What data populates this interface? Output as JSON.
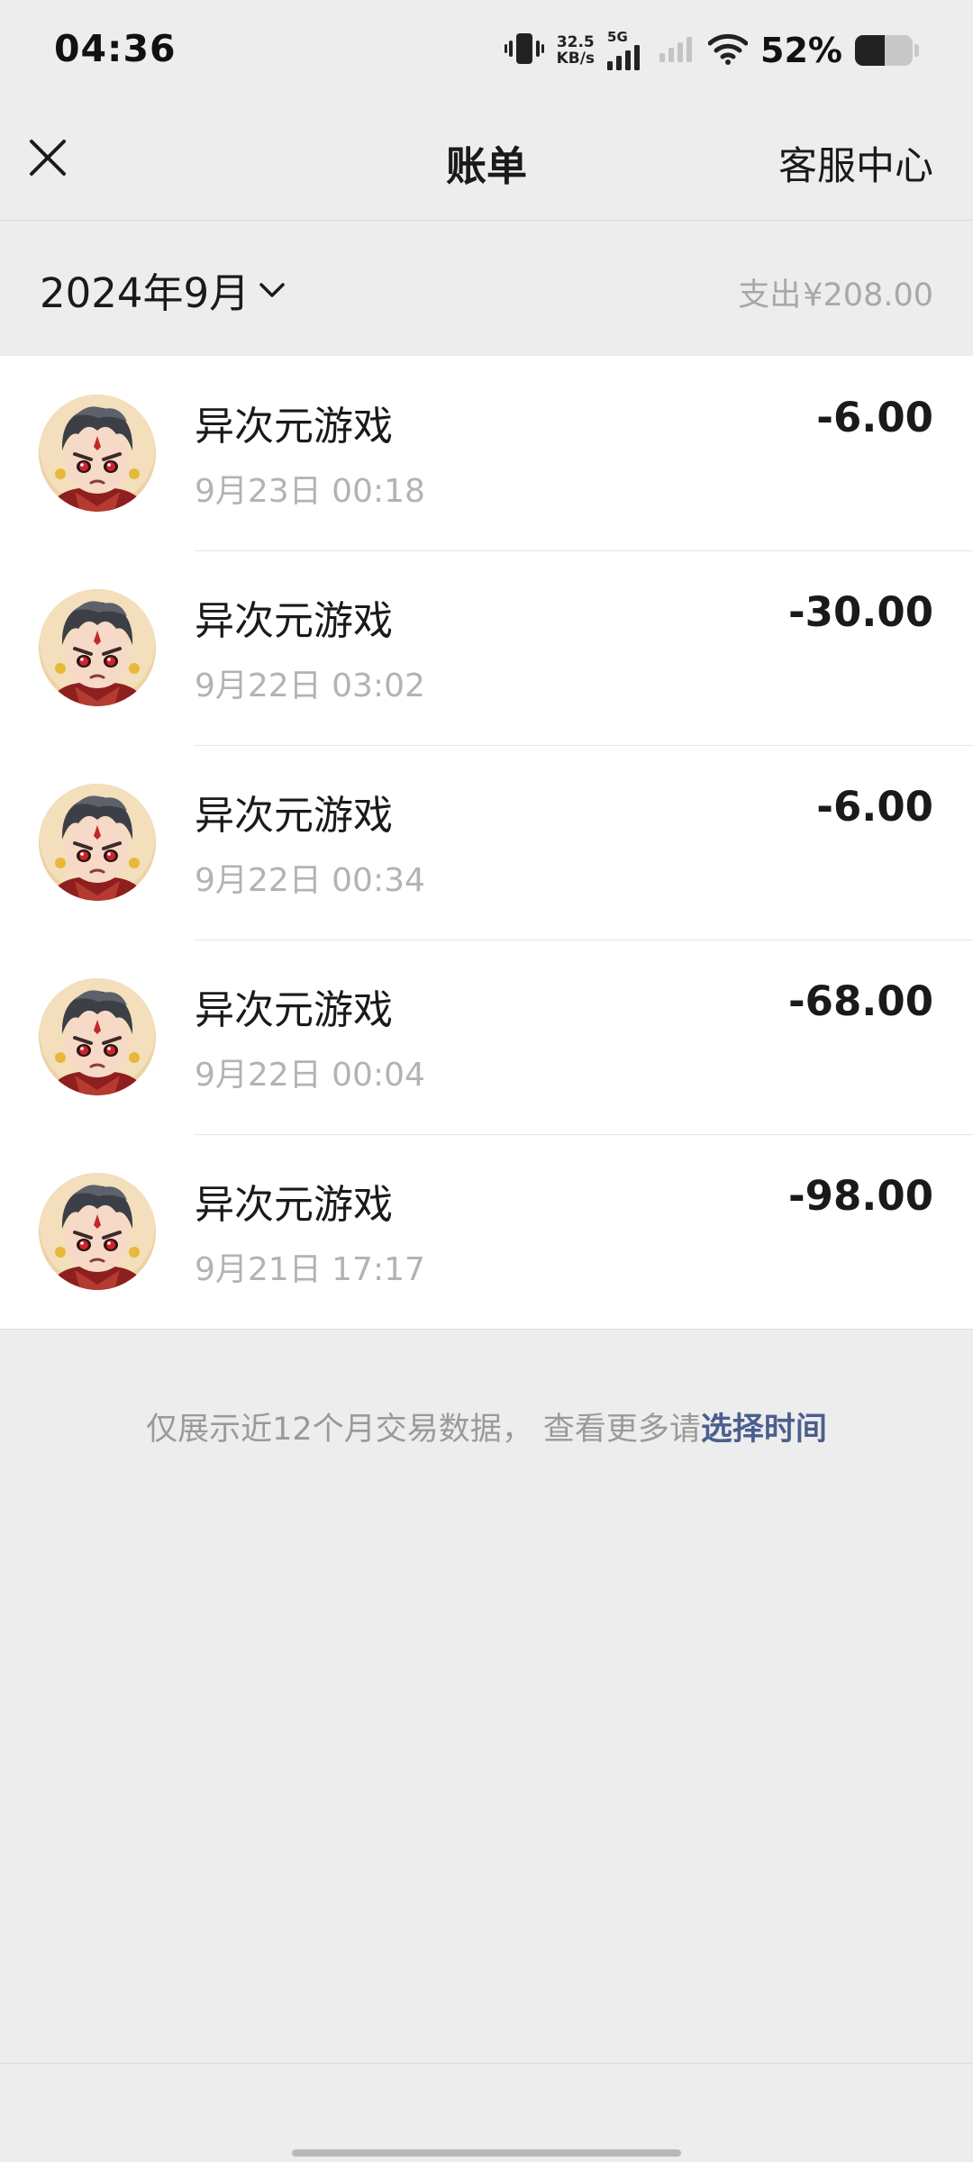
{
  "status_bar": {
    "time": "04:36",
    "net_speed_value": "32.5",
    "net_speed_unit": "KB/s",
    "network_type": "5G",
    "battery_percent": "52%",
    "battery_level": 0.52
  },
  "header": {
    "title": "账单",
    "right_link": "客服中心",
    "close_icon": "close-icon"
  },
  "filter": {
    "month": "2024年9月",
    "expense_label": "支出",
    "expense_amount": "¥208.00"
  },
  "transactions": [
    {
      "name": "异次元游戏",
      "time": "9月23日 00:18",
      "amount": "-6.00"
    },
    {
      "name": "异次元游戏",
      "time": "9月22日 03:02",
      "amount": "-30.00"
    },
    {
      "name": "异次元游戏",
      "time": "9月22日 00:34",
      "amount": "-6.00"
    },
    {
      "name": "异次元游戏",
      "time": "9月22日 00:04",
      "amount": "-68.00"
    },
    {
      "name": "异次元游戏",
      "time": "9月21日 17:17",
      "amount": "-98.00"
    }
  ],
  "footer": {
    "note": "仅展示近12个月交易数据， 查看更多请",
    "link": "选择时间"
  },
  "colors": {
    "background": "#ededed",
    "link": "#4a5f8f",
    "muted_text": "#a8a8a8"
  }
}
